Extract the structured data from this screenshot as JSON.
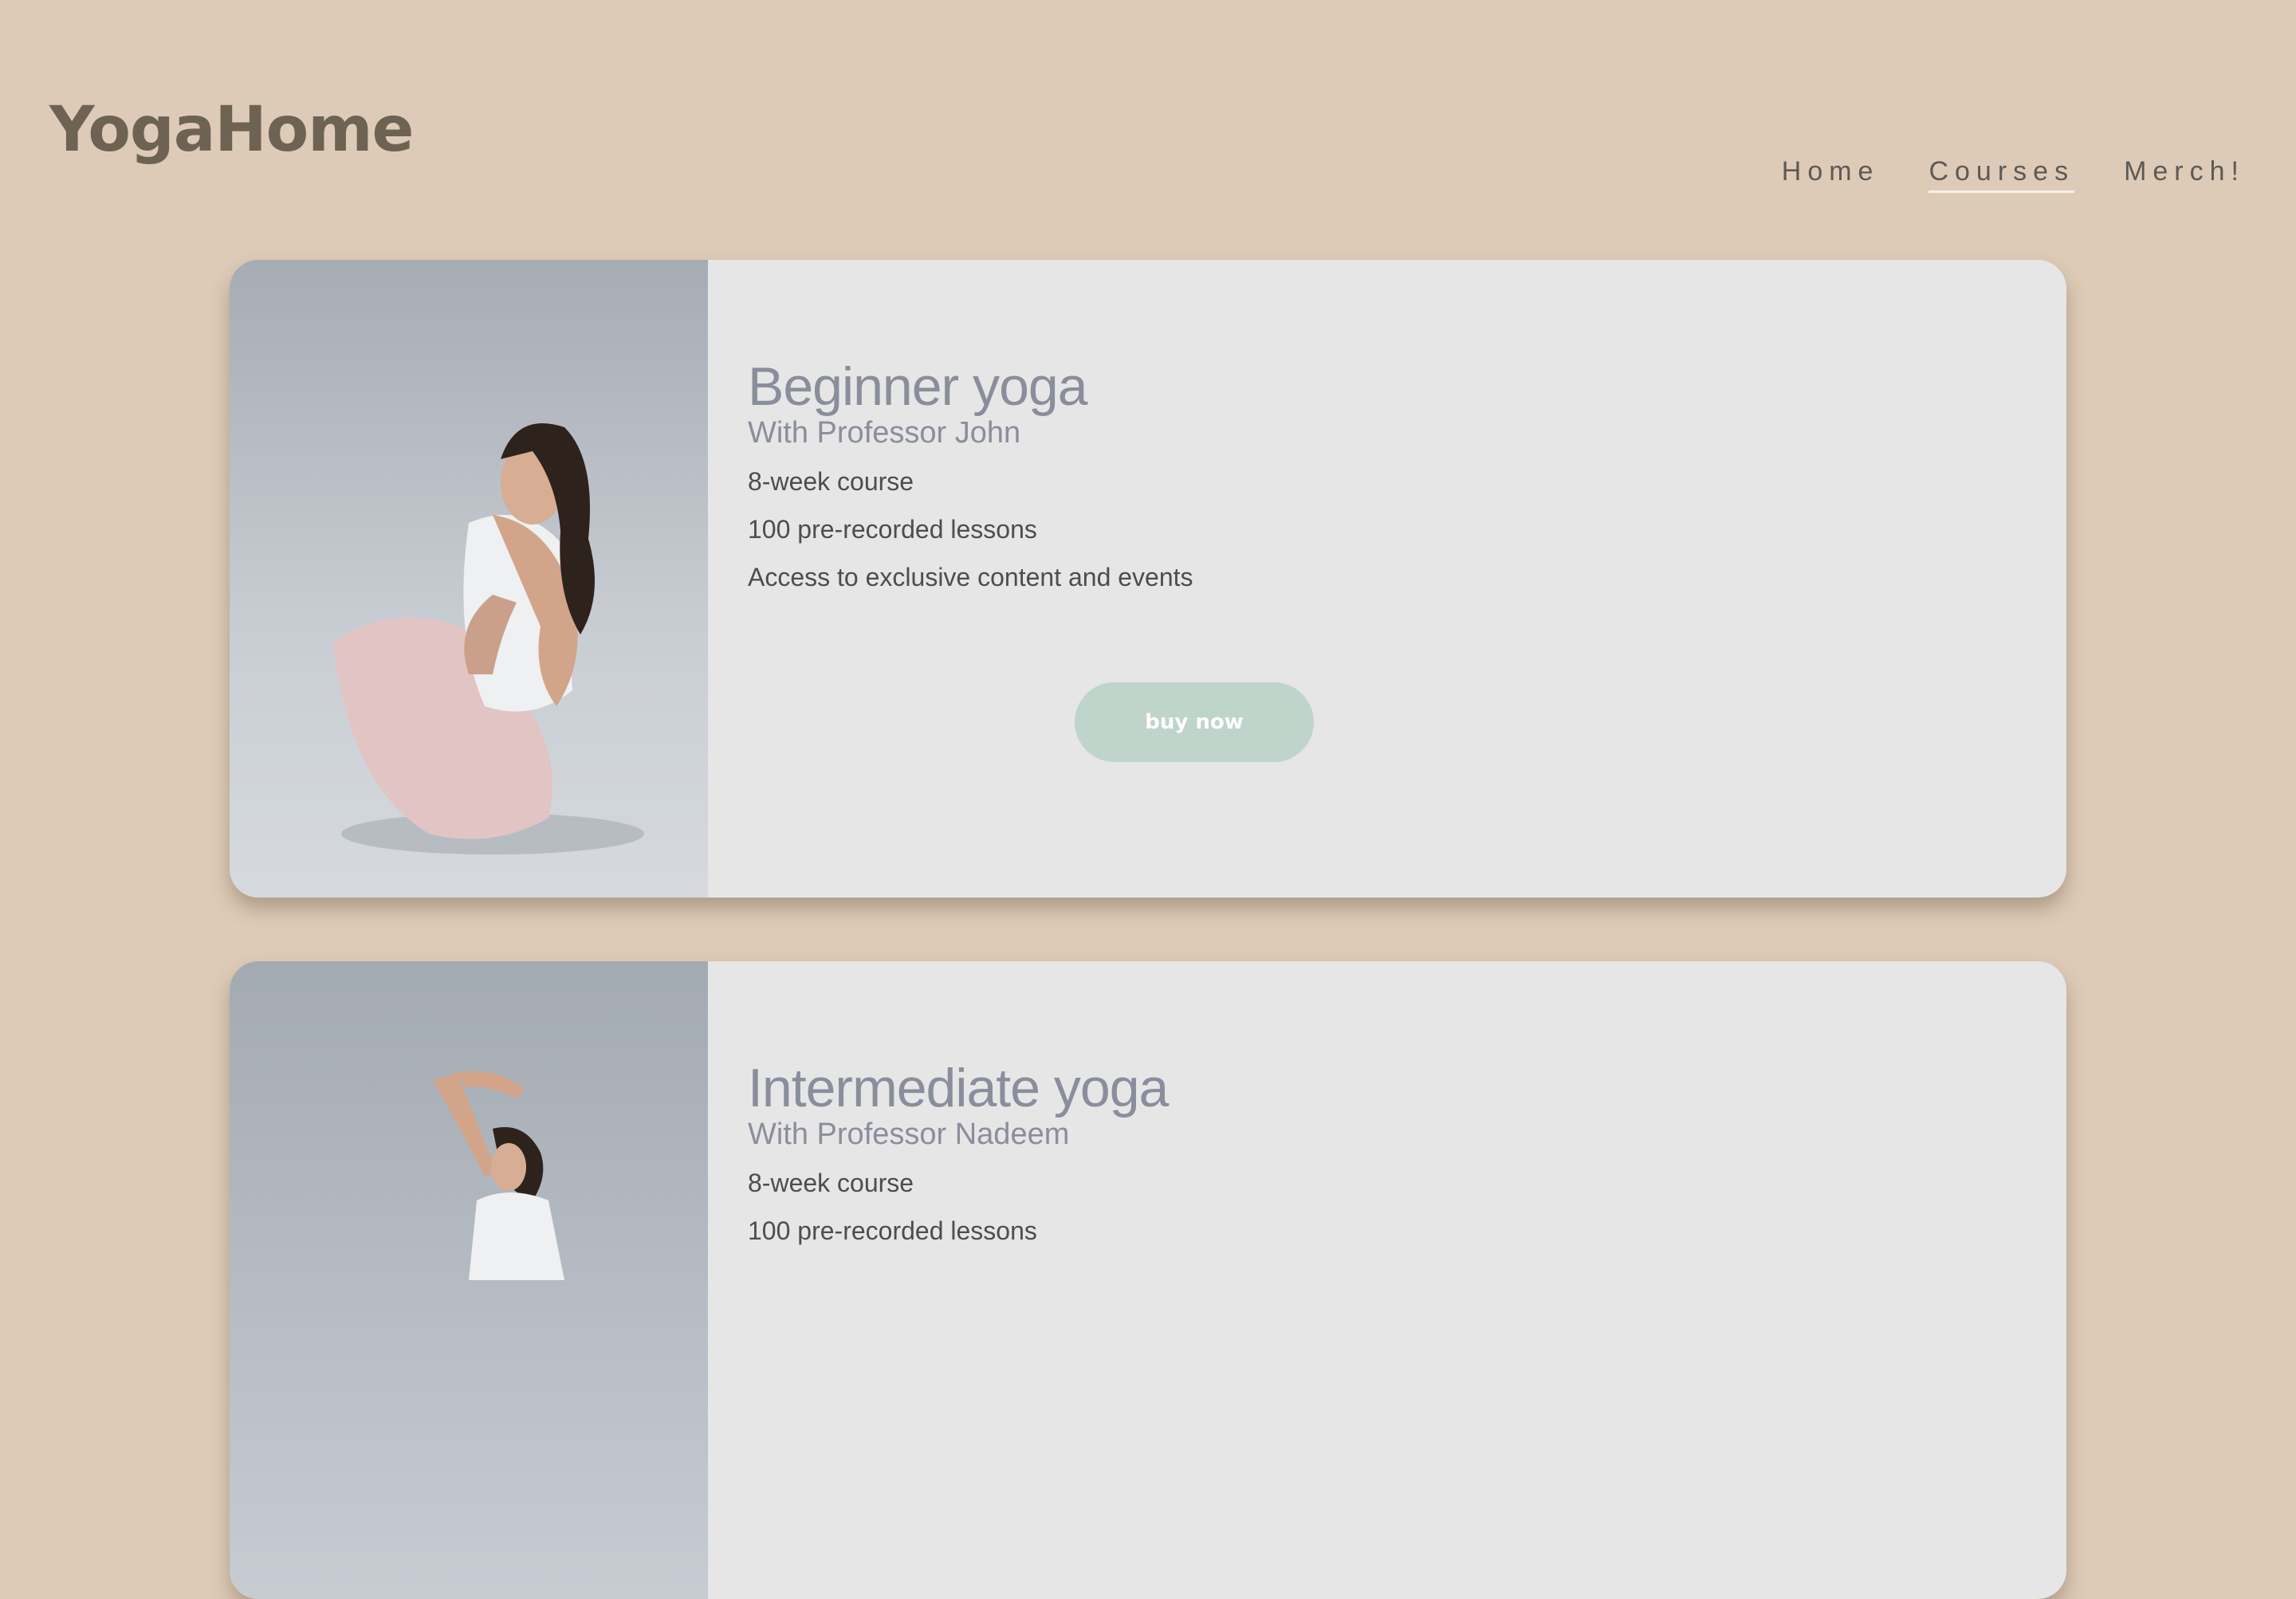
{
  "header": {
    "logo": "YogaHome",
    "nav": [
      {
        "label": "Home"
      },
      {
        "label": "Courses"
      },
      {
        "label": "Merch!"
      }
    ]
  },
  "courses": [
    {
      "title": "Beginner yoga",
      "instructor": "With Professor John",
      "features": [
        "8-week course",
        "100 pre-recorded lessons",
        "Access to exclusive content and events"
      ],
      "button_label": "buy now"
    },
    {
      "title": "Intermediate yoga",
      "instructor": "With Professor Nadeem",
      "features": [
        "8-week course",
        "100 pre-recorded lessons"
      ]
    }
  ],
  "colors": {
    "background": "#decbb7",
    "card": "#e6e6e6",
    "heading": "#8a8e9c",
    "button": "#bfd4cb",
    "logo": "#6e6353"
  }
}
